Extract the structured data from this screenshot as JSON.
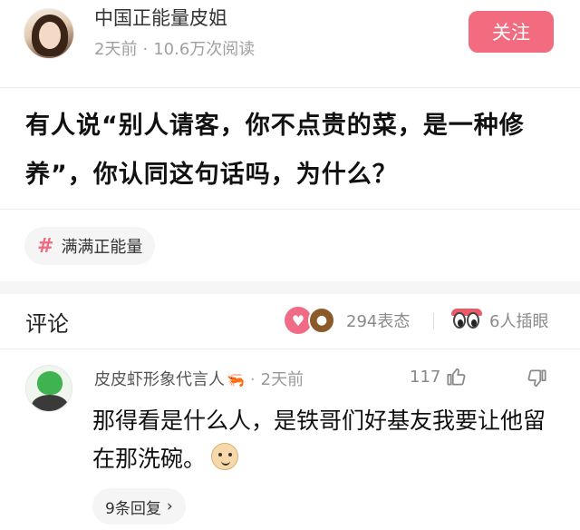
{
  "post": {
    "author": "中国正能量皮姐",
    "time": "2天前",
    "reads": "10.6万次阅读",
    "follow_label": "关注",
    "title": "有人说“别人请客，你不点贵的菜，是一种修养”，你认同这句话吗，为什么？",
    "tag": "满满正能量"
  },
  "comments_section": {
    "title": "评论",
    "reactions_count": "294表态",
    "watchers": "6人插眼"
  },
  "comment": {
    "user": "皮皮虾形象代言人",
    "time": "2天前",
    "likes": "117",
    "text": "那得看是什么人，是铁哥们好基友我要让他留在那洗碗。",
    "replies": "9条回复",
    "replies_chevron": "›"
  },
  "colors": {
    "accent": "#f26b7e",
    "tag_hash": "#ef6b82"
  }
}
